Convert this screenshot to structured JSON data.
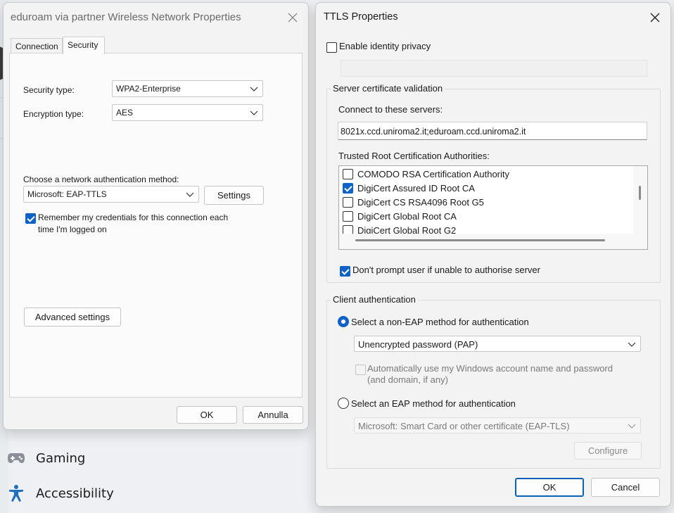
{
  "background": {
    "nav_items": [
      {
        "label": "Gaming",
        "icon": "gamepad-icon"
      },
      {
        "label": "Accessibility",
        "icon": "accessibility-icon"
      }
    ]
  },
  "network_dialog": {
    "title": "eduroam via partner Wireless Network Properties",
    "tabs": [
      {
        "label": "Connection",
        "selected": false
      },
      {
        "label": "Security",
        "selected": true
      }
    ],
    "security_type_label": "Security type:",
    "security_type_value": "WPA2-Enterprise",
    "encryption_type_label": "Encryption type:",
    "encryption_type_value": "AES",
    "auth_method_label": "Choose a network authentication method:",
    "auth_method_value": "Microsoft: EAP-TTLS",
    "settings_button": "Settings",
    "remember_credentials_line1": "Remember my credentials for this connection each",
    "remember_credentials_line2": "time I'm logged on",
    "remember_credentials_checked": true,
    "advanced_settings_button": "Advanced settings",
    "ok_button": "OK",
    "cancel_button": "Annulla"
  },
  "ttls_dialog": {
    "title": "TTLS Properties",
    "enable_identity_privacy": "Enable identity privacy",
    "enable_identity_privacy_checked": false,
    "identity_value": "",
    "server_cert_group": "Server certificate validation",
    "connect_servers_label": "Connect to these servers:",
    "connect_servers_value": "8021x.ccd.uniroma2.it;eduroam.ccd.uniroma2.it",
    "trusted_roots_label": "Trusted Root Certification Authorities:",
    "trusted_roots": [
      {
        "label": "COMODO RSA Certification Authority",
        "checked": false
      },
      {
        "label": "DigiCert Assured ID Root CA",
        "checked": true
      },
      {
        "label": "DigiCert CS RSA4096 Root G5",
        "checked": false
      },
      {
        "label": "DigiCert Global Root CA",
        "checked": false
      },
      {
        "label": "DigiCert Global Root G2",
        "checked": false
      }
    ],
    "dont_prompt": "Don't prompt user if unable to authorise server",
    "dont_prompt_checked": true,
    "client_auth_group": "Client authentication",
    "non_eap_radio": "Select a non-EAP method for authentication",
    "non_eap_selected": true,
    "non_eap_method_value": "Unencrypted password (PAP)",
    "auto_windows_line1": "Automatically use my Windows account name and password",
    "auto_windows_line2": "(and domain, if any)",
    "eap_radio": "Select an EAP method for authentication",
    "eap_method_value": "Microsoft: Smart Card or other certificate (EAP-TLS)",
    "configure_button": "Configure",
    "ok_button": "OK",
    "cancel_button": "Cancel"
  },
  "colors": {
    "accent": "#0f63c6",
    "window_bg": "#f3f3f3",
    "panel_bg": "#fbfbfb"
  }
}
